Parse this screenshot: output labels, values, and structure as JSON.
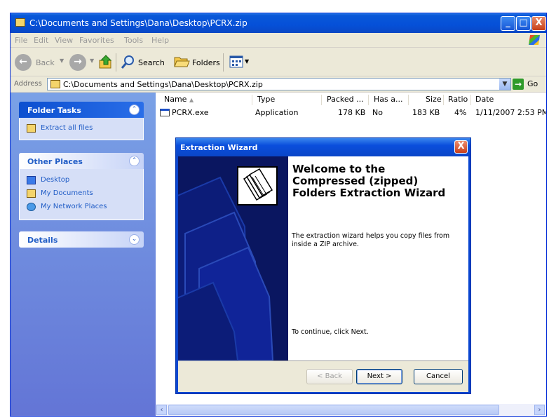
{
  "window": {
    "title": "C:\\Documents and Settings\\Dana\\Desktop\\PCRX.zip",
    "buttons": {
      "minimize": "_",
      "maximize": "□",
      "close": "X"
    }
  },
  "menu": [
    "File",
    "Edit",
    "View",
    "Favorites",
    "Tools",
    "Help"
  ],
  "toolbar": {
    "back": "Back",
    "search": "Search",
    "folders": "Folders"
  },
  "address": {
    "label": "Address",
    "value": "C:\\Documents and Settings\\Dana\\Desktop\\PCRX.zip",
    "go": "Go"
  },
  "left_pane": {
    "folder_tasks": {
      "title": "Folder Tasks",
      "items": [
        "Extract all files"
      ]
    },
    "other_places": {
      "title": "Other Places",
      "items": [
        "Desktop",
        "My Documents",
        "My Network Places"
      ]
    },
    "details": {
      "title": "Details"
    }
  },
  "file_list": {
    "columns": [
      "Name",
      "Type",
      "Packed ...",
      "Has a...",
      "Size",
      "Ratio",
      "Date"
    ],
    "rows": [
      {
        "name": "PCRX.exe",
        "type": "Application",
        "packed": "178 KB",
        "has": "No",
        "size": "183 KB",
        "ratio": "4%",
        "date": "1/11/2007 2:53 PM"
      }
    ]
  },
  "dialog": {
    "title": "Extraction Wizard",
    "close": "X",
    "heading": "Welcome to the Compressed (zipped) Folders Extraction Wizard",
    "description": "The extraction wizard helps you copy files from inside a ZIP archive.",
    "continue_text": "To continue, click Next.",
    "buttons": {
      "back": "< Back",
      "next": "Next >",
      "cancel": "Cancel"
    }
  },
  "colors": {
    "xp_blue": "#0a4edc",
    "task_pane": "#6c86da",
    "wizard_side": "#0a1660"
  }
}
